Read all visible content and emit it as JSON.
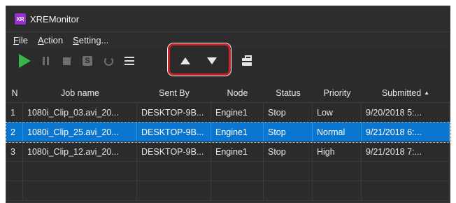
{
  "window": {
    "title": "XREMonitor",
    "logo_text": "XR"
  },
  "menu": [
    {
      "label": "File",
      "underline": "F",
      "rest": "ile"
    },
    {
      "label": "Action",
      "underline": "A",
      "rest": "ction"
    },
    {
      "label": "Setting...",
      "underline": "S",
      "rest": "etting..."
    }
  ],
  "toolbar": {
    "play_icon": "play-icon",
    "pause_icon": "pause-icon",
    "stop_icon": "stop-icon",
    "s_icon_text": "S",
    "refresh_icon": "refresh-icon",
    "list_icon": "list-icon",
    "move_up_icon": "move-up-icon",
    "move_down_icon": "move-down-icon",
    "toolbox_icon": "toolbox-icon",
    "play_color": "#3ab34a",
    "highlight_color": "#c4242a"
  },
  "grid": {
    "columns": [
      "N",
      "Job name",
      "Sent By",
      "Node",
      "Status",
      "Priority",
      "Submitted"
    ],
    "sort_indicator": "▲",
    "rows": [
      {
        "n": "1",
        "job": "1080i_Clip_03.avi_20...",
        "sent_by": "DESKTOP-9B...",
        "node": "Engine1",
        "status": "Stop",
        "priority": "Low",
        "submitted": "9/20/2018 5:..."
      },
      {
        "n": "2",
        "job": "1080i_Clip_25.avi_20...",
        "sent_by": "DESKTOP-9B...",
        "node": "Engine1",
        "status": "Stop",
        "priority": "Normal",
        "submitted": "9/21/2018 6:..."
      },
      {
        "n": "3",
        "job": "1080i_Clip_12.avi_20...",
        "sent_by": "DESKTOP-9B...",
        "node": "Engine1",
        "status": "Stop",
        "priority": "High",
        "submitted": "9/21/2018 7:..."
      }
    ],
    "selected_row": "2",
    "selection_color": "#0a76d0"
  }
}
